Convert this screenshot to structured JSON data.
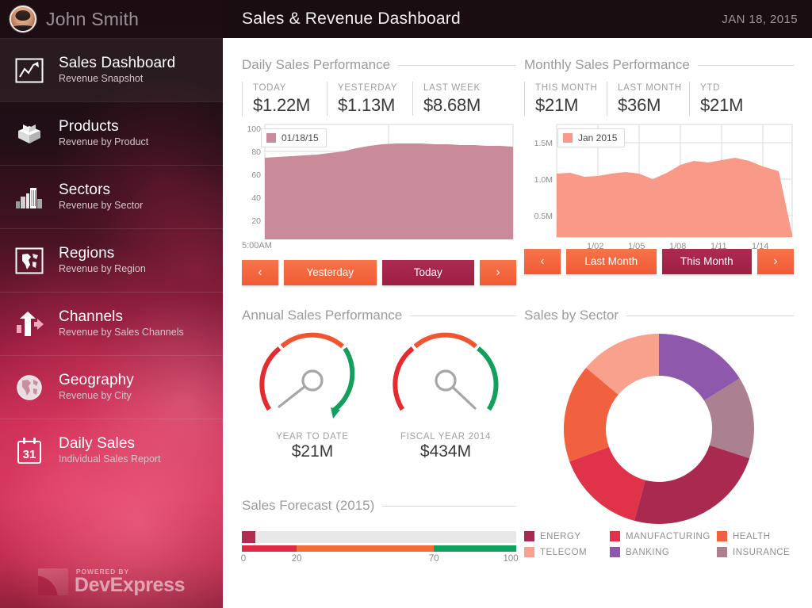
{
  "sidebar": {
    "user": {
      "name": "John Smith",
      "avatar_icon": "user-avatar-photo"
    },
    "items": [
      {
        "title": "Sales Dashboard",
        "subtitle": "Revenue Snapshot",
        "icon": "line-chart-icon",
        "active": true
      },
      {
        "title": "Products",
        "subtitle": "Revenue by Product",
        "icon": "open-box-icon",
        "active": false
      },
      {
        "title": "Sectors",
        "subtitle": "Revenue by Sector",
        "icon": "buildings-icon",
        "active": false
      },
      {
        "title": "Regions",
        "subtitle": "Revenue by Region",
        "icon": "world-map-framed-icon",
        "active": false
      },
      {
        "title": "Channels",
        "subtitle": "Revenue by Sales Channels",
        "icon": "arrows-up-right-icon",
        "active": false
      },
      {
        "title": "Geography",
        "subtitle": "Revenue by City",
        "icon": "globe-icon",
        "active": false
      },
      {
        "title": "Daily Sales",
        "subtitle": "Individual Sales Report",
        "icon": "calendar-31-icon",
        "active": false
      }
    ],
    "brand": {
      "powered_by": "POWERED BY",
      "name": "DevExpress",
      "logo_icon": "devexpress-swoosh-icon"
    }
  },
  "header": {
    "title": "Sales & Revenue Dashboard",
    "date": "JAN 18, 2015"
  },
  "daily_panel": {
    "title": "Daily Sales Performance",
    "kpis": [
      {
        "label": "TODAY",
        "value": "$1.22M"
      },
      {
        "label": "YESTERDAY",
        "value": "$1.13M"
      },
      {
        "label": "LAST WEEK",
        "value": "$8.68M"
      }
    ],
    "buttons": {
      "prev_icon": "chevron-left-icon",
      "prev_glyph": "‹",
      "yesterday": "Yesterday",
      "today": "Today",
      "next_icon": "chevron-right-icon",
      "next_glyph": "›"
    }
  },
  "monthly_panel": {
    "title": "Monthly Sales Performance",
    "kpis": [
      {
        "label": "THIS MONTH",
        "value": "$21M"
      },
      {
        "label": "LAST MONTH",
        "value": "$36M"
      },
      {
        "label": "YTD",
        "value": "$21M"
      }
    ],
    "buttons": {
      "prev_glyph": "‹",
      "last_month": "Last Month",
      "this_month": "This Month",
      "next_glyph": "›"
    }
  },
  "annual_panel": {
    "title": "Annual Sales Performance",
    "gauges": [
      {
        "label": "YEAR TO DATE",
        "value": "$21M",
        "needle_deg": 232,
        "has_arrow_tip": true
      },
      {
        "label": "FISCAL YEAR 2014",
        "value": "$434M",
        "needle_deg": 310,
        "has_arrow_tip": false
      }
    ]
  },
  "forecast_panel": {
    "title": "Sales Forecast (2015)",
    "value": 5,
    "ticks": [
      "0",
      "20",
      "70",
      "100"
    ]
  },
  "sector_panel": {
    "title": "Sales by Sector"
  },
  "colors": {
    "accent_orange": "#f2613f",
    "accent_dark": "#a52449",
    "daily_area": "#c98b9a",
    "monthly_area": "#f89a87",
    "gauge_red": "#e52b30",
    "gauge_orange": "#f0552f",
    "gauge_green": "#13a05c",
    "range_red": "#e02a43",
    "range_orange": "#f26c37",
    "range_green": "#0fa15e",
    "sidebar_dark": "#1a0d12"
  },
  "chart_data": [
    {
      "type": "area",
      "id": "daily-sales-area",
      "title": "Daily Sales Performance",
      "legend": [
        "01/18/15"
      ],
      "legend_position": "top-left",
      "xlabel": "",
      "ylabel": "",
      "x_tick_labels": [
        "5:00AM"
      ],
      "y_tick_labels": [
        "20",
        "40",
        "60",
        "80",
        "100"
      ],
      "ylim": [
        0,
        110
      ],
      "grid": true,
      "series": [
        {
          "name": "01/18/15",
          "color": "#c98b9a",
          "values": [
            82,
            83,
            84,
            85,
            86,
            87,
            88,
            90,
            92,
            93,
            94,
            94,
            94,
            93,
            93,
            93,
            92,
            92,
            92,
            91
          ]
        }
      ]
    },
    {
      "type": "area",
      "id": "monthly-sales-area",
      "title": "Monthly Sales Performance",
      "legend": [
        "Jan 2015"
      ],
      "legend_position": "top-left",
      "xlabel": "",
      "ylabel": "",
      "x_tick_labels": [
        "1/02",
        "1/05",
        "1/08",
        "1/11",
        "1/14"
      ],
      "y_tick_labels": [
        "0.5M",
        "1.0M",
        "1.5M"
      ],
      "ylim": [
        0,
        1700000
      ],
      "grid": true,
      "series": [
        {
          "name": "Jan 2015",
          "color": "#f89a87",
          "x": [
            "1/01",
            "1/02",
            "1/03",
            "1/04",
            "1/05",
            "1/06",
            "1/07",
            "1/08",
            "1/09",
            "1/10",
            "1/11",
            "1/12",
            "1/13",
            "1/14",
            "1/15",
            "1/16",
            "1/17",
            "1/18"
          ],
          "values": [
            1080000,
            1090000,
            1035000,
            1040000,
            1080000,
            1100000,
            1090000,
            1010000,
            1090000,
            1200000,
            1260000,
            1240000,
            1270000,
            1310000,
            1270000,
            1190000,
            1130000,
            250000
          ]
        }
      ]
    },
    {
      "type": "gauge",
      "id": "ytd-gauge",
      "title": "YEAR TO DATE",
      "display_value": "$21M",
      "needle_angle_deg": 232,
      "arc_bands": [
        {
          "name": "low",
          "color": "#e52b30",
          "from_deg": 225,
          "to_deg": 290
        },
        {
          "name": "mid",
          "color": "#f0552f",
          "from_deg": 290,
          "to_deg": 55
        },
        {
          "name": "high",
          "color": "#13a05c",
          "from_deg": 55,
          "to_deg": 135
        }
      ]
    },
    {
      "type": "gauge",
      "id": "fiscal-2014-gauge",
      "title": "FISCAL YEAR 2014",
      "display_value": "$434M",
      "needle_angle_deg": 310,
      "arc_bands": [
        {
          "name": "low",
          "color": "#e52b30",
          "from_deg": 225,
          "to_deg": 290
        },
        {
          "name": "mid",
          "color": "#f0552f",
          "from_deg": 290,
          "to_deg": 55
        },
        {
          "name": "high",
          "color": "#13a05c",
          "from_deg": 55,
          "to_deg": 135
        }
      ]
    },
    {
      "type": "bar",
      "id": "sales-forecast-bullet",
      "subtype": "bullet",
      "title": "Sales Forecast (2015)",
      "categories": [
        "Sales Forecast (2015)"
      ],
      "values": [
        5
      ],
      "xlim": [
        0,
        100
      ],
      "tick_values": [
        0,
        20,
        70,
        100
      ],
      "tick_labels": [
        "0",
        "20",
        "70",
        "100"
      ],
      "ranges": [
        {
          "from": 0,
          "to": 20,
          "color": "#e02a43"
        },
        {
          "from": 20,
          "to": 70,
          "color": "#f26c37"
        },
        {
          "from": 70,
          "to": 100,
          "color": "#0fa15e"
        }
      ],
      "bar_color": "#b02c51",
      "track_color": "#e8e8e8"
    },
    {
      "type": "pie",
      "id": "sales-by-sector-donut",
      "subtype": "donut",
      "title": "Sales by Sector",
      "legend_position": "bottom",
      "labels": [
        "ENERGY",
        "MANUFACTURING",
        "HEALTH",
        "TELECOM",
        "BANKING",
        "INSURANCE"
      ],
      "values": [
        24,
        15.5,
        16.5,
        14,
        16,
        14
      ],
      "colors": [
        "#aa2a4f",
        "#e0334a",
        "#f2613f",
        "#f9a18c",
        "#8e58ad",
        "#ab8090"
      ],
      "slice_order_clockwise_from_top": [
        "BANKING",
        "INSURANCE",
        "ENERGY",
        "MANUFACTURING",
        "HEALTH",
        "TELECOM"
      ],
      "inner_radius_ratio": 0.56
    }
  ]
}
